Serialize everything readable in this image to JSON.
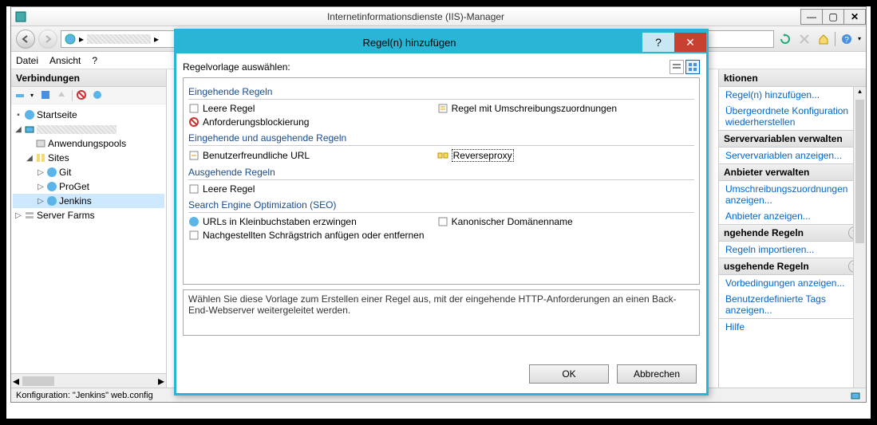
{
  "mainwin": {
    "title": "Internetinformationsdienste (IIS)-Manager",
    "menu": {
      "file": "Datei",
      "view": "Ansicht",
      "help": "?"
    }
  },
  "breadcrumb_sep": "▸",
  "connections": {
    "header": "Verbindungen",
    "nodes": {
      "start": "Startseite",
      "apppools": "Anwendungspools",
      "sites": "Sites",
      "git": "Git",
      "proget": "ProGet",
      "jenkins": "Jenkins",
      "serverfarms": "Server Farms"
    }
  },
  "actions": {
    "header": "ktionen",
    "add_rules": "Regel(n) hinzufügen...",
    "restore_parent": "Übergeordnete Konfiguration wiederherstellen",
    "srv_vars_head": "Servervariablen verwalten",
    "srv_vars_show": "Servervariablen anzeigen...",
    "providers_head": "Anbieter verwalten",
    "rewrite_maps": "Umschreibungszuordnungen anzeigen...",
    "providers_show": "Anbieter anzeigen...",
    "inbound_head": "ngehende Regeln",
    "import_rules": "Regeln importieren...",
    "outbound_head": "usgehende Regeln",
    "preconds": "Vorbedingungen anzeigen...",
    "custom_tags": "Benutzerdefinierte Tags anzeigen...",
    "help": "Hilfe"
  },
  "status": "Konfiguration: \"Jenkins\" web.config",
  "dialog": {
    "title": "Regel(n) hinzufügen",
    "choose": "Regelvorlage auswählen:",
    "sections": {
      "inbound": "Eingehende Regeln",
      "inout": "Eingehende und ausgehende Regeln",
      "outbound": "Ausgehende Regeln",
      "seo": "Search Engine Optimization (SEO)"
    },
    "items": {
      "blank_in": "Leere Regel",
      "rewrite_map": "Regel mit Umschreibungszuordnungen",
      "block": "Anforderungsblockierung",
      "friendly": "Benutzerfreundliche URL",
      "revproxy": "Reverseproxy",
      "blank_out": "Leere Regel",
      "lowercase": "URLs in Kleinbuchstaben erzwingen",
      "canonical": "Kanonischer Domänenname",
      "trailslash": "Nachgestellten Schrägstrich anfügen oder entfernen"
    },
    "description": "Wählen Sie diese Vorlage zum Erstellen einer Regel aus, mit der eingehende HTTP-Anforderungen an einen Back-End-Webserver weitergeleitet werden.",
    "ok": "OK",
    "cancel": "Abbrechen"
  }
}
